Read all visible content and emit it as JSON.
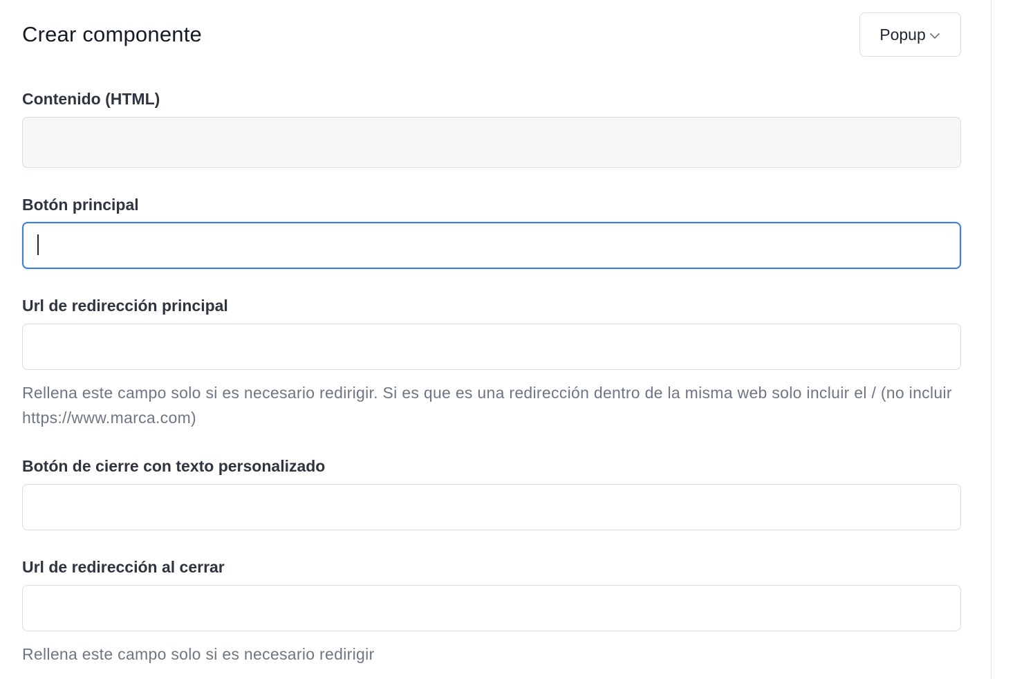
{
  "header": {
    "title": "Crear componente",
    "type_selector": {
      "selected": "Popup"
    }
  },
  "fields": {
    "content_html": {
      "label": "Contenido (HTML)",
      "value": ""
    },
    "main_button": {
      "label": "Botón principal",
      "value": ""
    },
    "main_redirect_url": {
      "label": "Url de redirección principal",
      "value": "",
      "help": "Rellena este campo solo si es necesario redirigir. Si es que es una redirección dentro de la misma web solo incluir el / (no incluir https://www.marca.com)"
    },
    "close_button_text": {
      "label": "Botón de cierre con texto personalizado",
      "value": ""
    },
    "close_redirect_url": {
      "label": "Url de redirección al cerrar",
      "value": "",
      "help": "Rellena este campo solo si es necesario redirigir"
    }
  },
  "colors": {
    "focus_border": "#3b7ddd",
    "input_border": "#d9dce1",
    "disabled_bg": "#f6f7f9",
    "help_text": "#6f7683"
  },
  "icons": {
    "type_selector": "chevron-down-icon"
  }
}
